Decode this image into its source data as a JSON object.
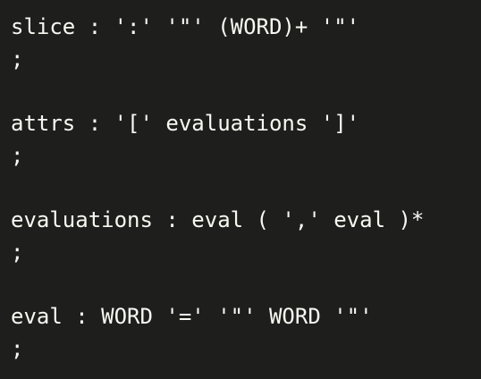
{
  "editor": {
    "lines": [
      "slice : ':' '\"' (WORD)+ '\"'",
      ";",
      "",
      "attrs : '[' evaluations ']'",
      ";",
      "",
      "evaluations : eval ( ',' eval )*",
      ";",
      "",
      "eval : WORD '=' '\"' WORD '\"'",
      ";"
    ],
    "colors": {
      "background": "#1e1f1c",
      "text": "#f8f8f2"
    }
  }
}
